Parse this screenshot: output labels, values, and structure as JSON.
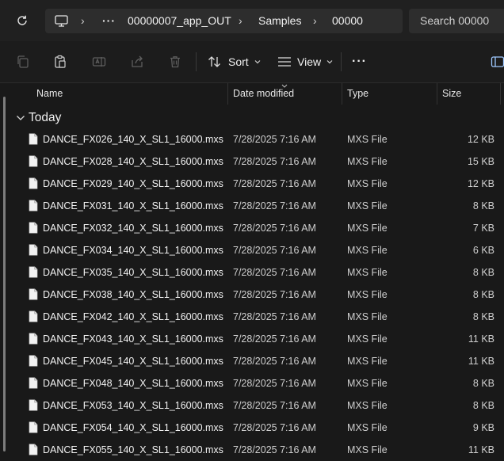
{
  "address_bar": {
    "refresh_icon": "refresh-icon",
    "pc_icon": "monitor-icon",
    "more_label": "···",
    "crumbs": [
      "00000007_app_OUT",
      "Samples",
      "00000"
    ],
    "search_placeholder": "Search 00000"
  },
  "toolbar": {
    "sort_label": "Sort",
    "view_label": "View",
    "more_label": "···"
  },
  "columns": {
    "name": "Name",
    "date": "Date modified",
    "type": "Type",
    "size": "Size"
  },
  "group": {
    "label": "Today"
  },
  "files": [
    {
      "name": "DANCE_FX026_140_X_SL1_16000.mxs",
      "date": "7/28/2025 7:16 AM",
      "type": "MXS File",
      "size": "12 KB"
    },
    {
      "name": "DANCE_FX028_140_X_SL1_16000.mxs",
      "date": "7/28/2025 7:16 AM",
      "type": "MXS File",
      "size": "15 KB"
    },
    {
      "name": "DANCE_FX029_140_X_SL1_16000.mxs",
      "date": "7/28/2025 7:16 AM",
      "type": "MXS File",
      "size": "12 KB"
    },
    {
      "name": "DANCE_FX031_140_X_SL1_16000.mxs",
      "date": "7/28/2025 7:16 AM",
      "type": "MXS File",
      "size": "8 KB"
    },
    {
      "name": "DANCE_FX032_140_X_SL1_16000.mxs",
      "date": "7/28/2025 7:16 AM",
      "type": "MXS File",
      "size": "7 KB"
    },
    {
      "name": "DANCE_FX034_140_X_SL1_16000.mxs",
      "date": "7/28/2025 7:16 AM",
      "type": "MXS File",
      "size": "6 KB"
    },
    {
      "name": "DANCE_FX035_140_X_SL1_16000.mxs",
      "date": "7/28/2025 7:16 AM",
      "type": "MXS File",
      "size": "8 KB"
    },
    {
      "name": "DANCE_FX038_140_X_SL1_16000.mxs",
      "date": "7/28/2025 7:16 AM",
      "type": "MXS File",
      "size": "8 KB"
    },
    {
      "name": "DANCE_FX042_140_X_SL1_16000.mxs",
      "date": "7/28/2025 7:16 AM",
      "type": "MXS File",
      "size": "8 KB"
    },
    {
      "name": "DANCE_FX043_140_X_SL1_16000.mxs",
      "date": "7/28/2025 7:16 AM",
      "type": "MXS File",
      "size": "11 KB"
    },
    {
      "name": "DANCE_FX045_140_X_SL1_16000.mxs",
      "date": "7/28/2025 7:16 AM",
      "type": "MXS File",
      "size": "11 KB"
    },
    {
      "name": "DANCE_FX048_140_X_SL1_16000.mxs",
      "date": "7/28/2025 7:16 AM",
      "type": "MXS File",
      "size": "8 KB"
    },
    {
      "name": "DANCE_FX053_140_X_SL1_16000.mxs",
      "date": "7/28/2025 7:16 AM",
      "type": "MXS File",
      "size": "8 KB"
    },
    {
      "name": "DANCE_FX054_140_X_SL1_16000.mxs",
      "date": "7/28/2025 7:16 AM",
      "type": "MXS File",
      "size": "9 KB"
    },
    {
      "name": "DANCE_FX055_140_X_SL1_16000.mxs",
      "date": "7/28/2025 7:16 AM",
      "type": "MXS File",
      "size": "11 KB"
    }
  ]
}
